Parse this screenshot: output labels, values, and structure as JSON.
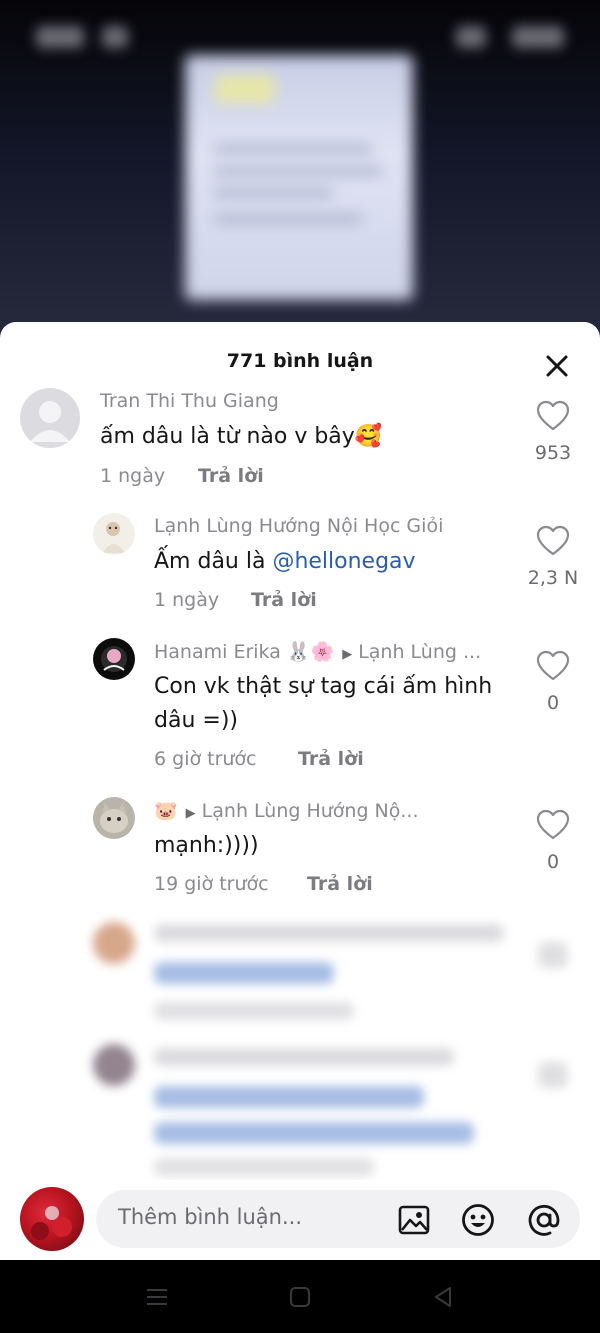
{
  "sheet": {
    "title": "771 bình luận"
  },
  "comments": [
    {
      "user": "Tran Thi Thu Giang",
      "text": "ấm dâu là từ nào v bây🥰",
      "time": "1 ngày",
      "reply": "Trả lời",
      "likes": "953"
    },
    {
      "user": "Lạnh Lùng Hướng Nội Học Giỏi",
      "text_prefix": "Ấm dâu là ",
      "mention": "@hellonegav",
      "time": "1 ngày",
      "reply": "Trả lời",
      "likes": "2,3 N"
    },
    {
      "user": "Hanami Erika 🐰🌸",
      "reply_to": "Lạnh Lùng ...",
      "text_line1": "Con vk thật sự tag cái ấm hình",
      "text_line2": "dâu =))",
      "time": "6 giờ trước",
      "reply": "Trả lời",
      "likes": "0"
    },
    {
      "user": "🐷",
      "reply_to": "Lạnh Lùng Hướng Nộ...",
      "text": "mạnh:))))",
      "time": "19 giờ trước",
      "reply": "Trả lời",
      "likes": "0"
    }
  ],
  "composer": {
    "placeholder": "Thêm bình luận..."
  },
  "icons": {
    "close": "close-icon",
    "like": "heart-outline-icon",
    "image": "image-icon",
    "emoji": "emoji-icon",
    "mention": "at-icon",
    "nav_menu": "menu-icon",
    "nav_home": "square-icon",
    "nav_back": "triangle-back-icon"
  },
  "colors": {
    "mention": "#2b5dab",
    "sheet_bg": "#ffffff",
    "muted_text": "#8a8a8f"
  }
}
